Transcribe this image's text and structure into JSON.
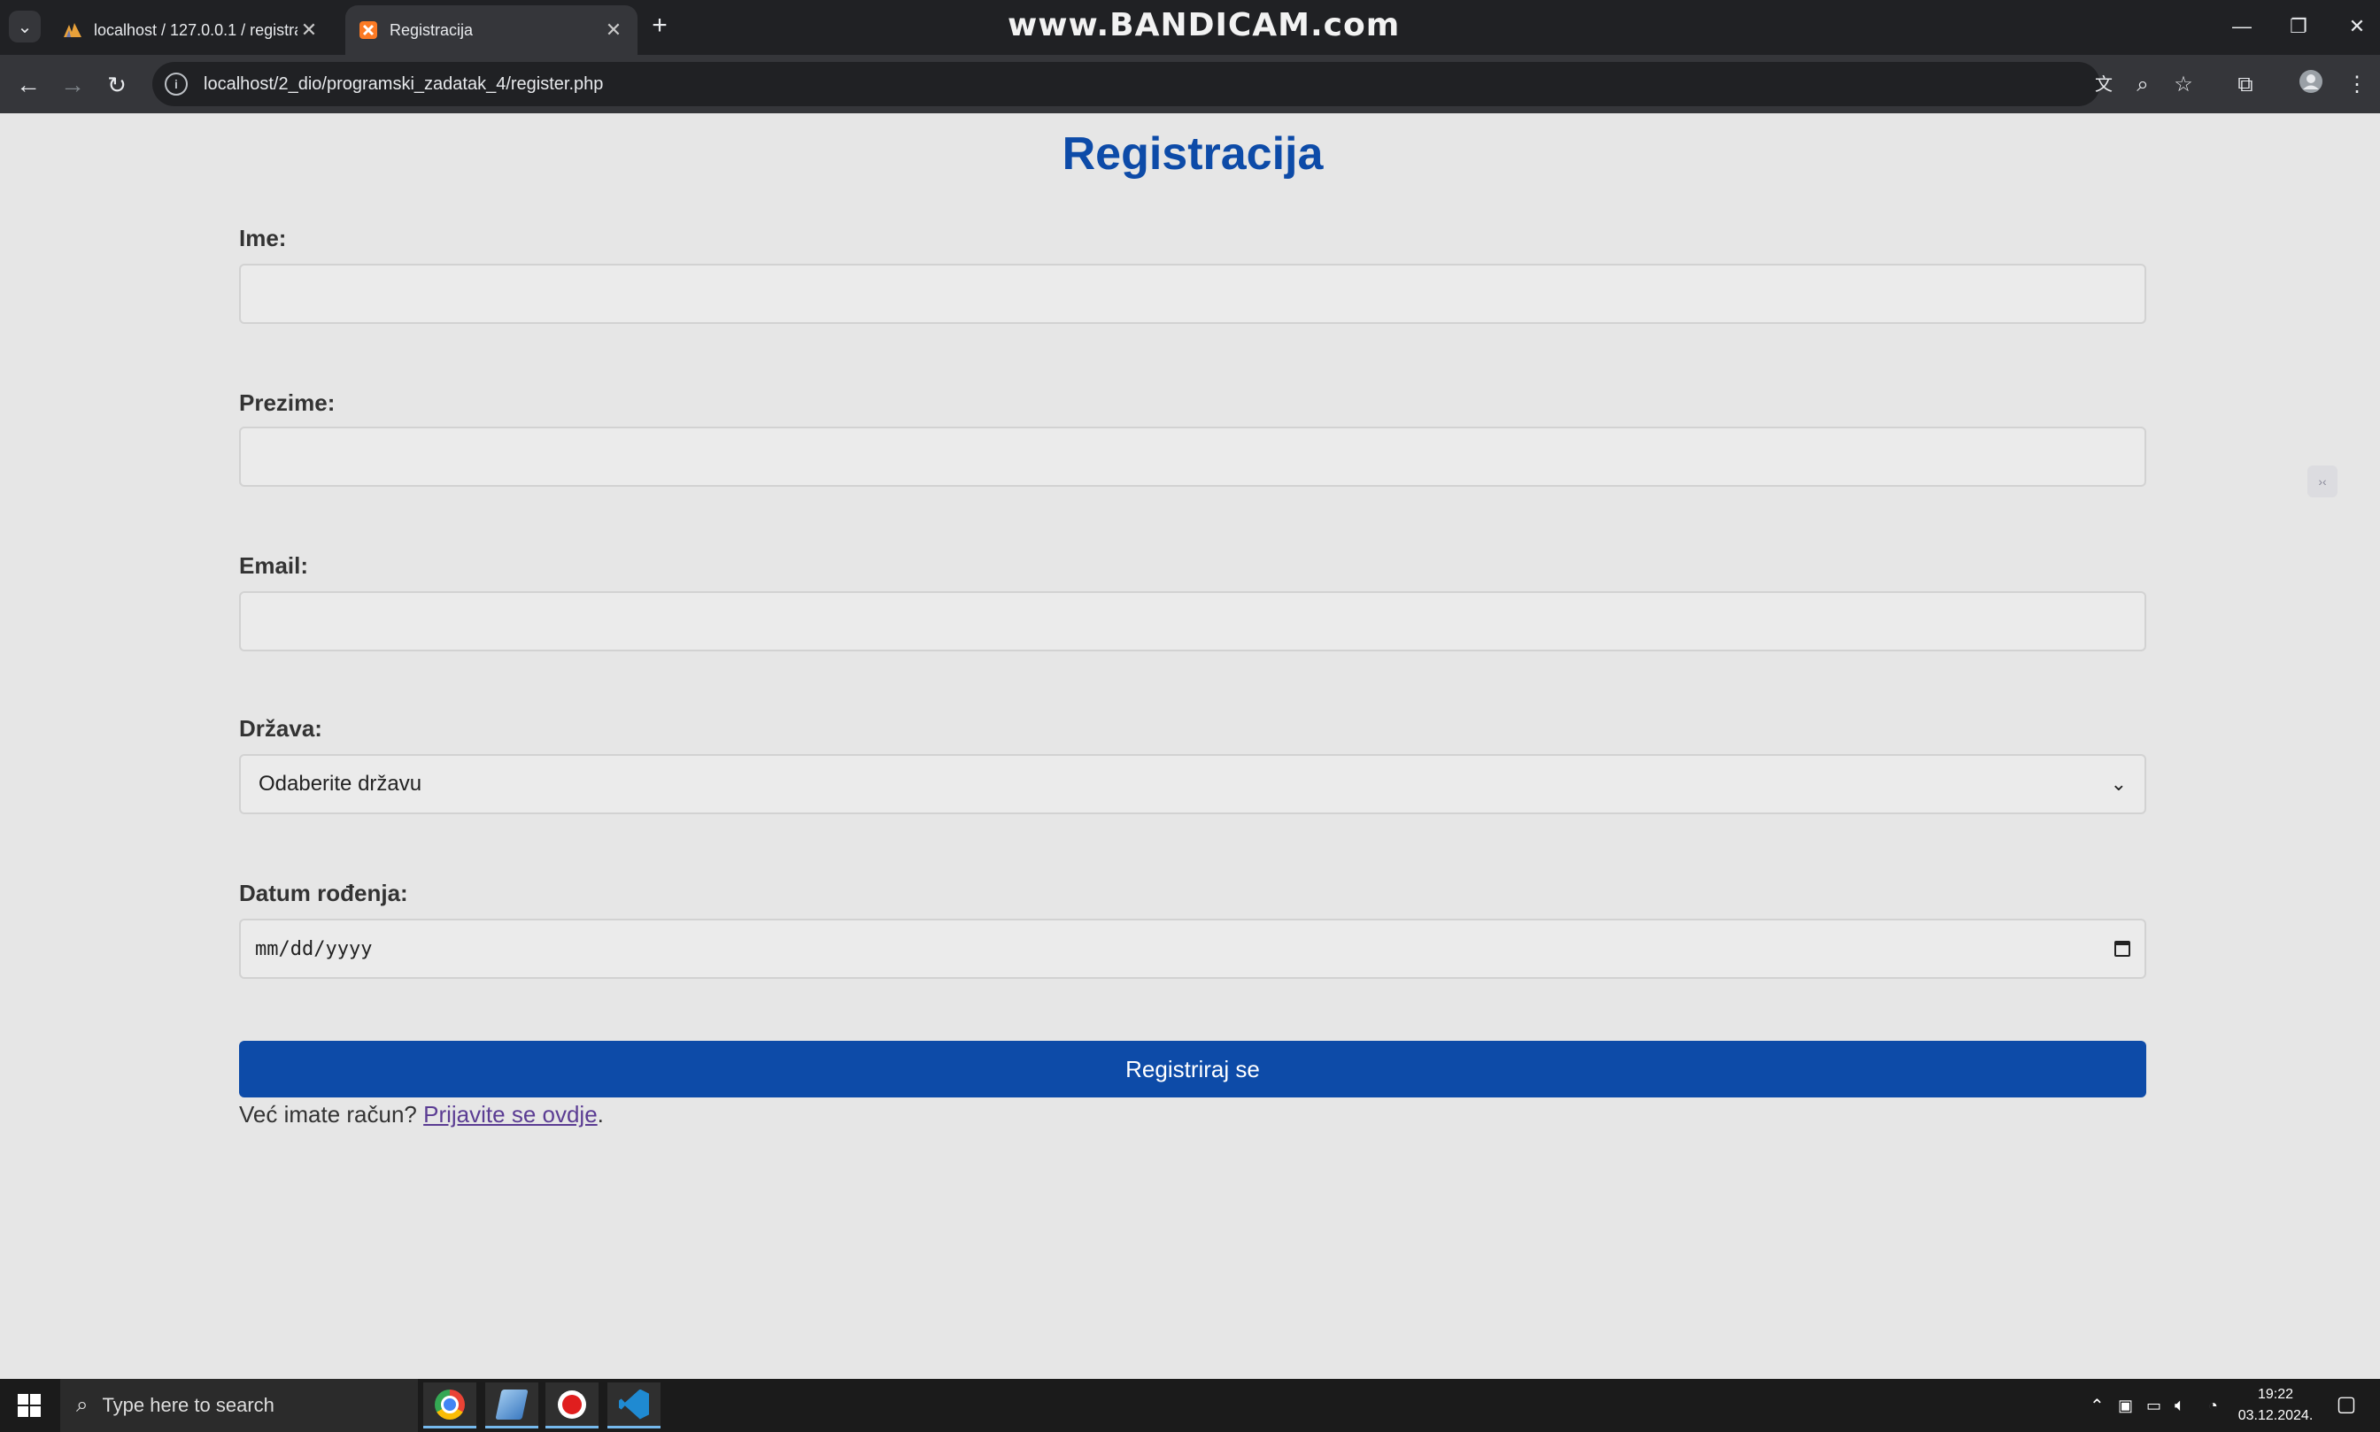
{
  "browser": {
    "tabs": [
      {
        "title": "localhost / 127.0.0.1 / registracija",
        "active": false,
        "favicon": "phpmyadmin-icon"
      },
      {
        "title": "Registracija",
        "active": true,
        "favicon": "xampp-icon"
      }
    ],
    "new_tab_symbol": "+",
    "watermark": "www.BANDICAM.com",
    "url": "localhost/2_dio/programski_zadatak_4/register.php",
    "window_controls": [
      "minimize",
      "restore",
      "close"
    ]
  },
  "page": {
    "title": "Registracija",
    "fields": [
      {
        "label": "Ime:",
        "value": ""
      },
      {
        "label": "Prezime:",
        "value": ""
      },
      {
        "label": "Email:",
        "value": ""
      }
    ],
    "country": {
      "label": "Država:",
      "selected": "Odaberite državu"
    },
    "birthdate": {
      "label": "Datum rođenja:",
      "placeholder": "mm/dd/yyyy"
    },
    "submit_label": "Registriraj se",
    "login_prompt": "Već imate račun?",
    "login_link": "Prijavite se ovdje",
    "login_suffix": "."
  },
  "taskbar": {
    "search_placeholder": "Type here to search",
    "apps": [
      "chrome-icon",
      "notepad-icon",
      "bandicam-icon",
      "vscode-icon"
    ],
    "time": "19:22",
    "date": "03.12.2024."
  },
  "colors": {
    "accent": "#0d4ba8",
    "page_background": "#e6e6e6",
    "link": "#5b3c93"
  }
}
